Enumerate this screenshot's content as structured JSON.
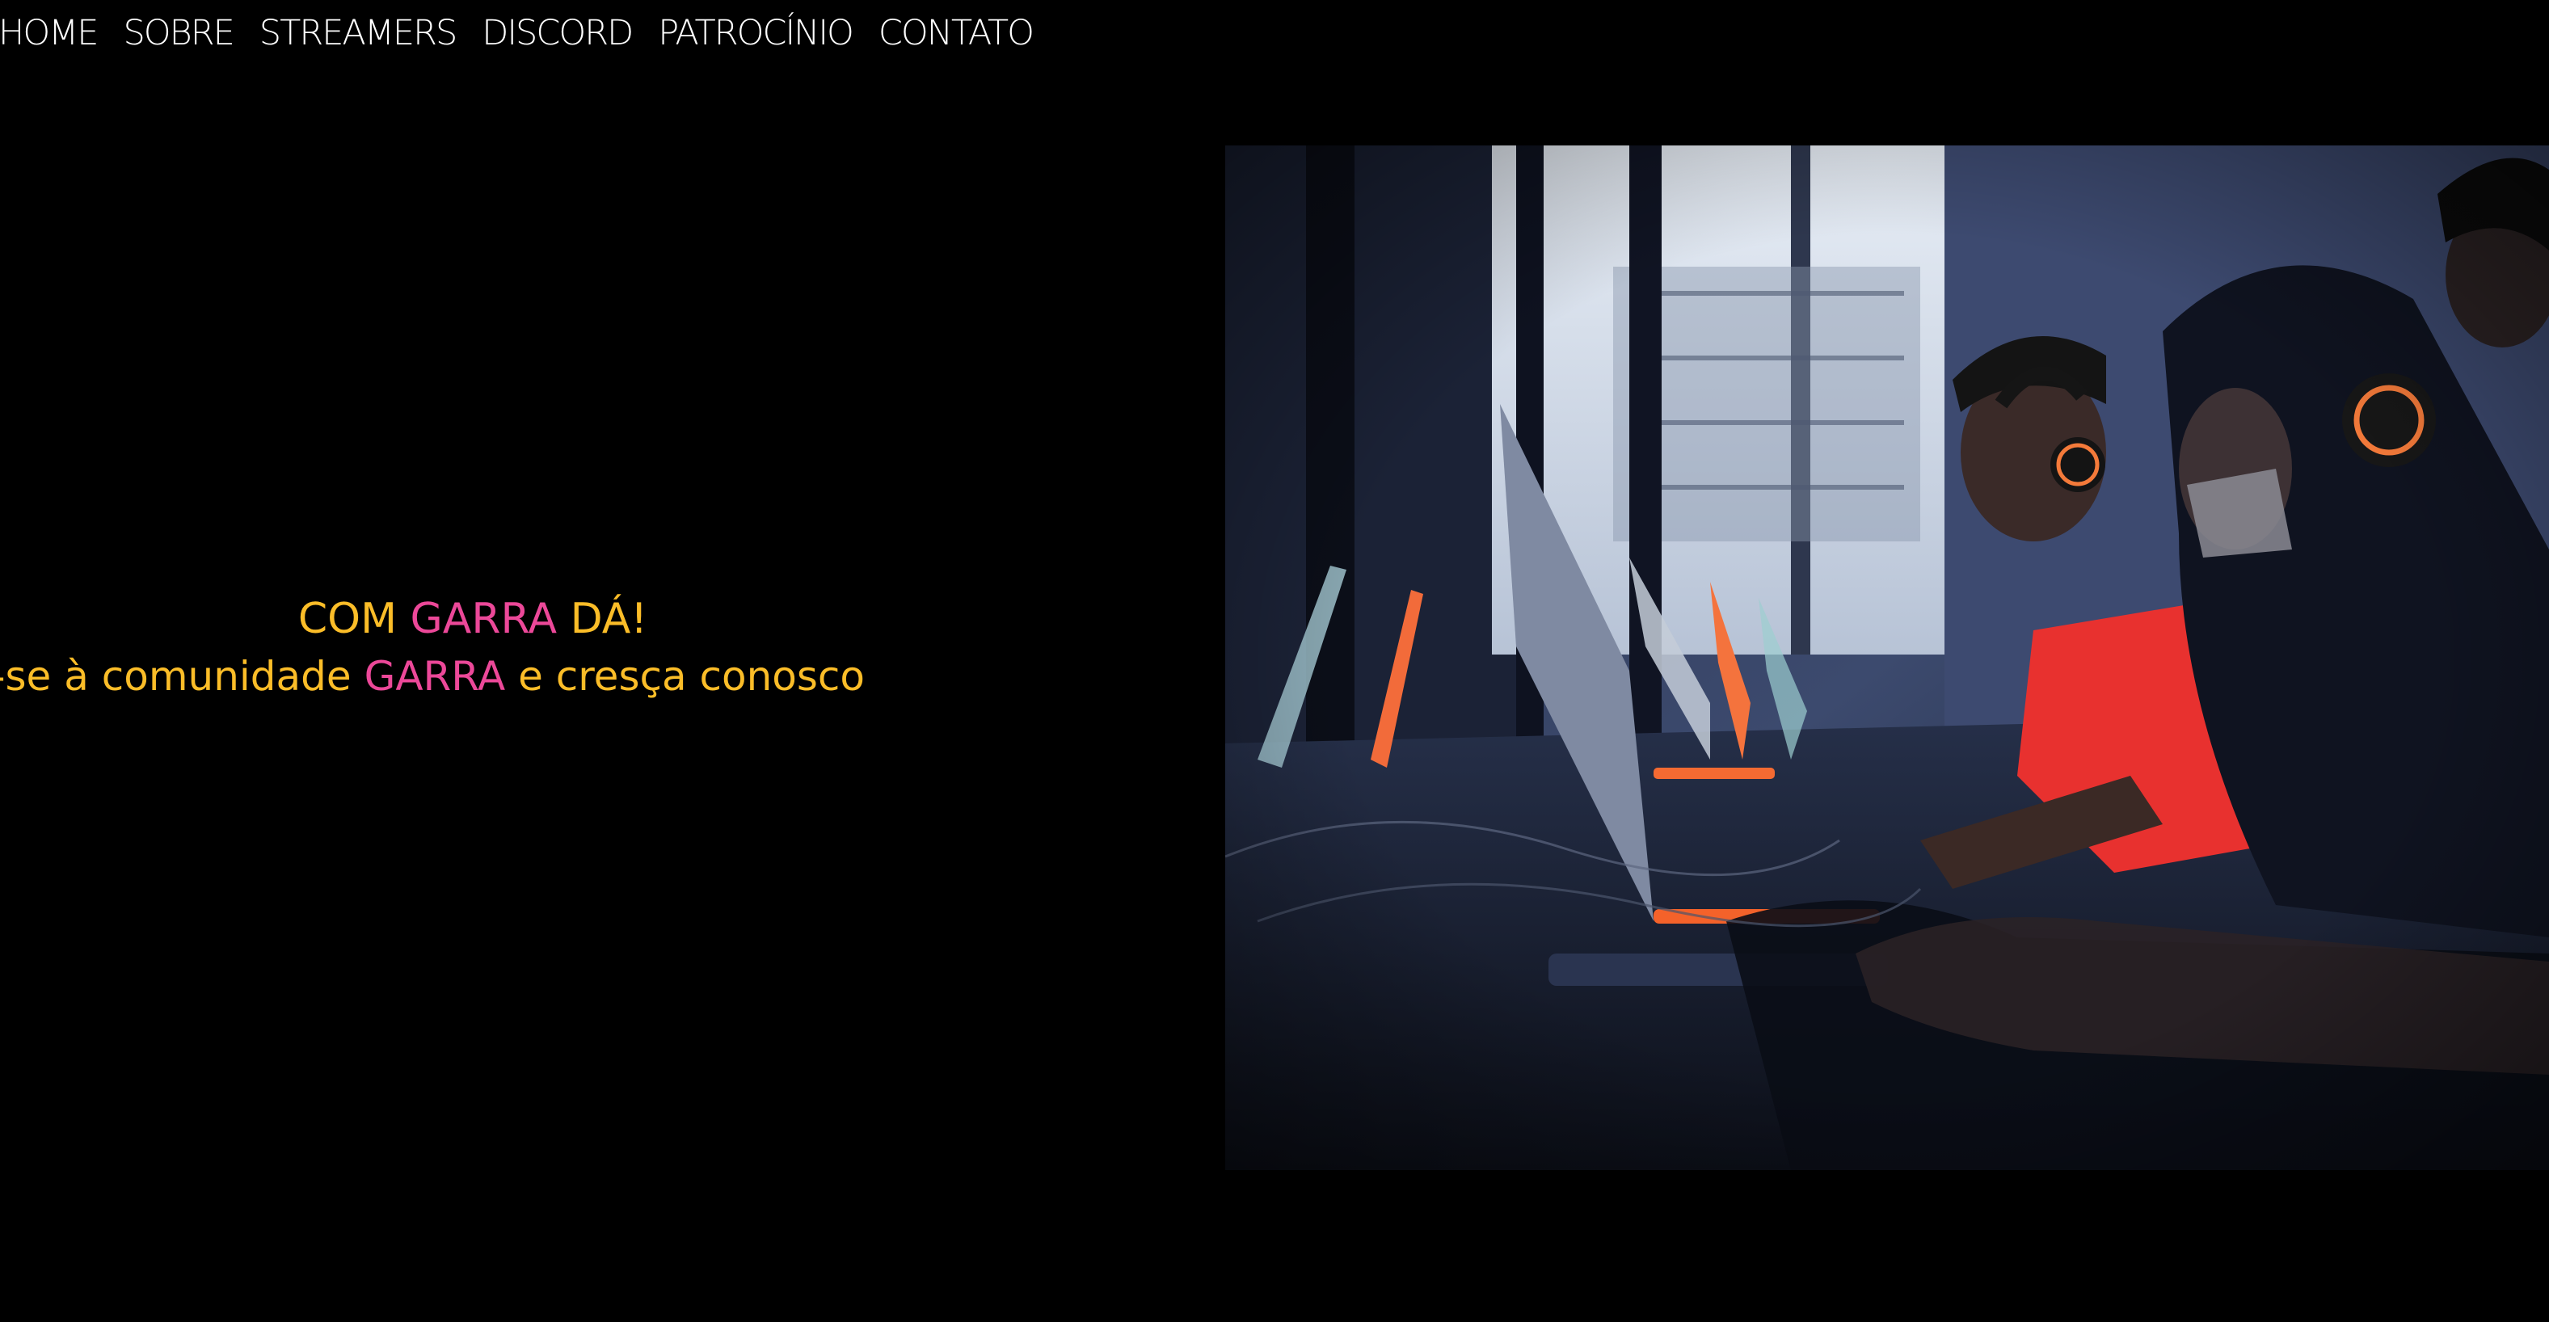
{
  "nav": {
    "items": [
      {
        "label": "HOME"
      },
      {
        "label": "SOBRE"
      },
      {
        "label": "STREAMERS"
      },
      {
        "label": "DISCORD"
      },
      {
        "label": "PATROCÍNIO"
      },
      {
        "label": "CONTATO"
      }
    ]
  },
  "hero": {
    "line1_part1": "COM ",
    "line1_accent": "GARRA",
    "line1_part2": " DÁ!",
    "line2_part1": "Junte-se à comunidade ",
    "line2_accent": "GARRA",
    "line2_part2": " e cresça conosco"
  },
  "colors": {
    "background": "#000000",
    "nav_text": "#ffffff",
    "hero_text": "#fbbd28",
    "accent": "#ec4899"
  },
  "photo": {
    "subject": "gamers-at-lan-event-photo"
  }
}
